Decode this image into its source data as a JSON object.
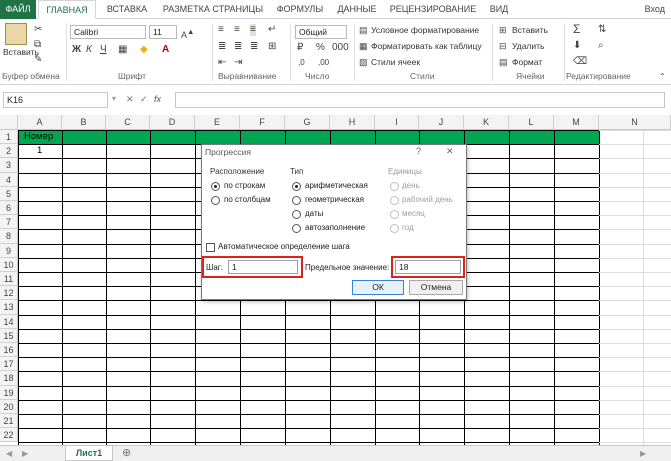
{
  "ribbon_tabs": [
    "ФАЙЛ",
    "ГЛАВНАЯ",
    "ВСТАВКА",
    "РАЗМЕТКА СТРАНИЦЫ",
    "ФОРМУЛЫ",
    "ДАННЫЕ",
    "РЕЦЕНЗИРОВАНИЕ",
    "ВИД"
  ],
  "login": "Вход",
  "ribbon": {
    "paste_label": "Вставить",
    "font_name": "Calibri",
    "font_size": "11",
    "bold": "Ж",
    "italic": "К",
    "underline": "Ч",
    "number_format": "Общий",
    "conditional_formatting": "Условное форматирование",
    "format_as_table": "Форматировать как таблицу",
    "cell_styles": "Стили ячеек",
    "insert": "Вставить",
    "delete": "Удалить",
    "format": "Формат",
    "groups": {
      "clipboard": "Буфер обмена",
      "font": "Шрифт",
      "alignment": "Выравнивание",
      "number": "Число",
      "styles": "Стили",
      "cells": "Ячейки",
      "editing": "Редактирование"
    }
  },
  "formula_bar": {
    "name_box": "K16",
    "cancel": "✕",
    "enter": "✓",
    "fx": "fx"
  },
  "grid": {
    "columns": [
      "A",
      "B",
      "C",
      "D",
      "E",
      "F",
      "G",
      "H",
      "I",
      "J",
      "K",
      "L",
      "M",
      "N"
    ],
    "rows": [
      "1",
      "2",
      "3",
      "4",
      "5",
      "6",
      "7",
      "8",
      "9",
      "10",
      "11",
      "12",
      "13",
      "14",
      "15",
      "16",
      "17",
      "18",
      "19",
      "20",
      "21",
      "22"
    ],
    "a1": "Номер",
    "a2": "1"
  },
  "sheet_tab": "Лист1",
  "dialog": {
    "title": "Прогрессия",
    "help": "?",
    "close": "✕",
    "placement": {
      "title": "Расположение",
      "by_rows": "по строкам",
      "by_columns": "по столбцам",
      "selected": "by_rows"
    },
    "type": {
      "title": "Тип",
      "arithmetic": "арифметическая",
      "geometric": "геометрическая",
      "dates": "даты",
      "autofill": "автозаполнение",
      "selected": "arithmetic"
    },
    "units": {
      "title": "Единицы",
      "day": "день",
      "workday": "рабочий день",
      "month": "месяц",
      "year": "год"
    },
    "auto_step": "Автоматическое определение шага",
    "step_label": "Шаг:",
    "step_value": "1",
    "limit_label": "Предельное значение:",
    "limit_value": "18",
    "ok": "ОК",
    "cancel": "Отмена"
  }
}
